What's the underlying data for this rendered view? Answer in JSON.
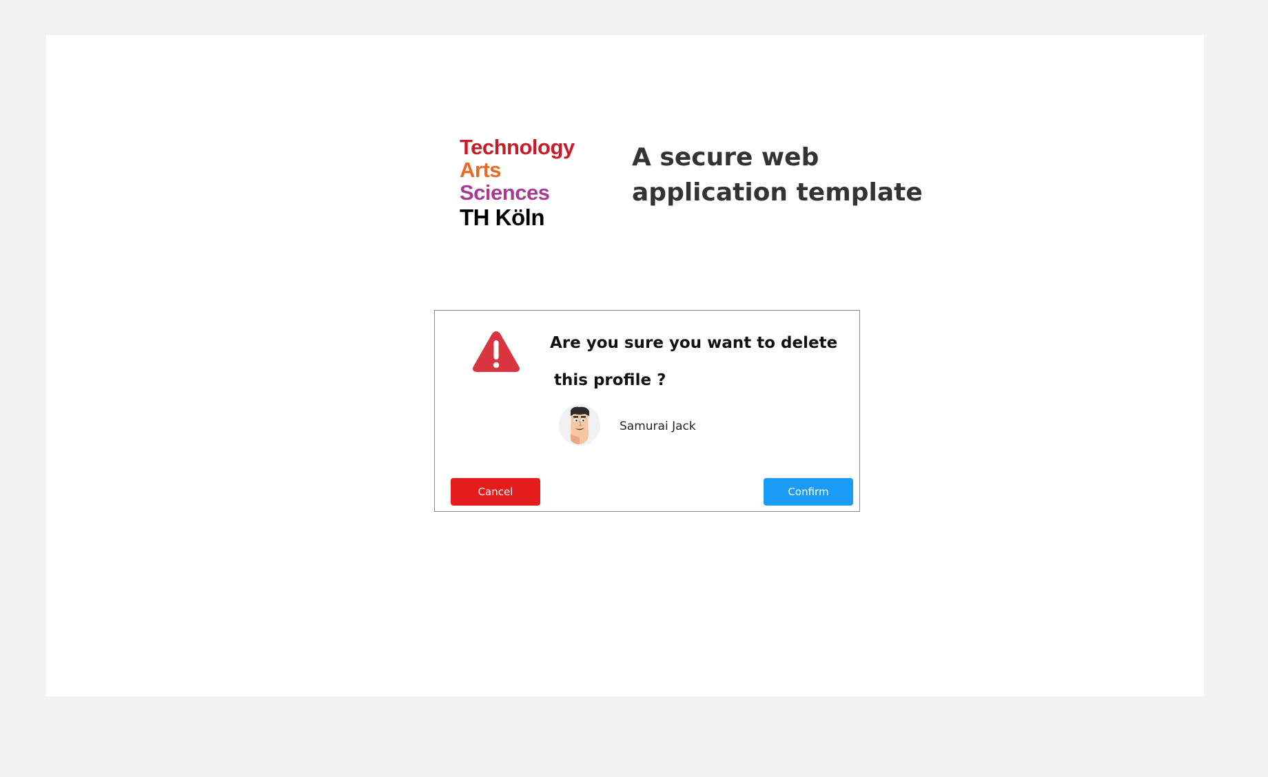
{
  "logo": {
    "line1": "Technology",
    "line2_a": "Arts",
    "line2_b": "Sciences",
    "line3": "TH Köln"
  },
  "header": {
    "title": "A secure web application template"
  },
  "dialog": {
    "question_line1": "Are you sure you want to delete",
    "question_line2": "this profile ?",
    "profile_name": "Samurai Jack",
    "cancel_label": "Cancel",
    "confirm_label": "Confirm",
    "icon": "warning-triangle-icon"
  },
  "colors": {
    "background": "#f2f2f2",
    "card": "#ffffff",
    "cancel": "#e41c1c",
    "confirm": "#1a9bf5",
    "warning": "#d7353f",
    "logo_red": "#c81b2a",
    "logo_orange": "#ea6a24",
    "logo_purple": "#a73a93"
  }
}
